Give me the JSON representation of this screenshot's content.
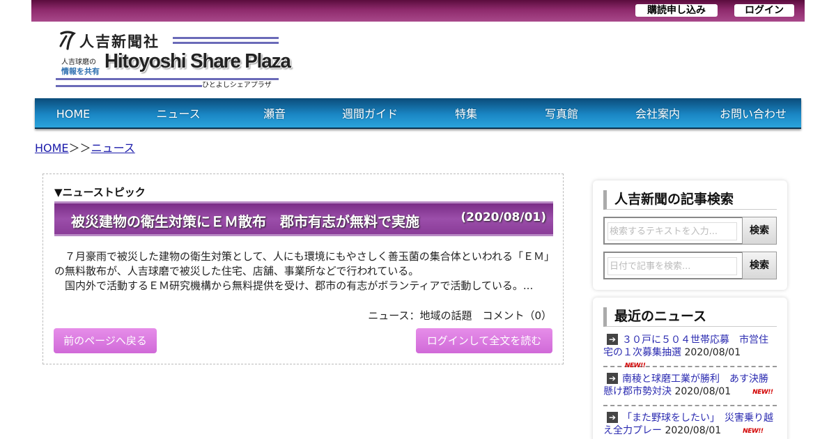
{
  "header": {
    "subscribe_label": "購読申し込み",
    "login_label": "ログイン"
  },
  "logo": {
    "jp_name": "人吉新聞社",
    "tag_line1": "人吉球磨の",
    "tag_line2": "情報を共有",
    "en_name": "Hitoyoshi Share Plaza",
    "kana_name": "ひとよしシェアプラザ"
  },
  "nav": {
    "items": [
      "HOME",
      "ニュース",
      "瀬音",
      "週間ガイド",
      "特集",
      "写真館",
      "会社案内",
      "お問い合わせ"
    ]
  },
  "breadcrumb": {
    "home": "HOME",
    "separator": "＞＞",
    "current": "ニュース"
  },
  "article": {
    "section_label": "▼ニューストピック",
    "title": "被災建物の衛生対策にＥＭ散布　郡市有志が無料で実施",
    "date": "(2020/08/01)",
    "body_line1": "　７月豪雨で被災した建物の衛生対策として、人にも環境にもやさしく善玉菌の集合体といわれる「ＥＭ」の無料散布が、人吉球磨で被災した住宅、店舗、事業所などで行われている。",
    "body_line2": "　国内外で活動するＥＭ研究機構から無料提供を受け、郡市の有志がボランティアで活動している。...",
    "meta": "ニュース：地域の話題　コメント（0）",
    "back_label": "前のページへ戻る",
    "read_label": "ログインして全文を読む"
  },
  "search": {
    "heading": "人吉新聞の記事検索",
    "text_placeholder": "検索するテキストを入力...",
    "date_placeholder": "日付で記事を検索...",
    "button_label": "検索"
  },
  "recent": {
    "heading": "最近のニュース",
    "new_badge": "NEW!!",
    "items": [
      {
        "title": "３０戸に５０４世帯応募　市営住宅の１次募集抽選",
        "date": "2020/08/01"
      },
      {
        "title": "南稜と球磨工業が勝利　あす決勝懸け郡市勢対決",
        "date": "2020/08/01"
      },
      {
        "title": "「また野球をしたい」　災害乗り越え全力プレー",
        "date": "2020/08/01"
      }
    ]
  },
  "colors": {
    "topbar": "#8e2a6c",
    "nav": "#1a86c4",
    "headline": "#9b4eaa",
    "button": "#d06ad8",
    "link": "#1a1aaa"
  }
}
